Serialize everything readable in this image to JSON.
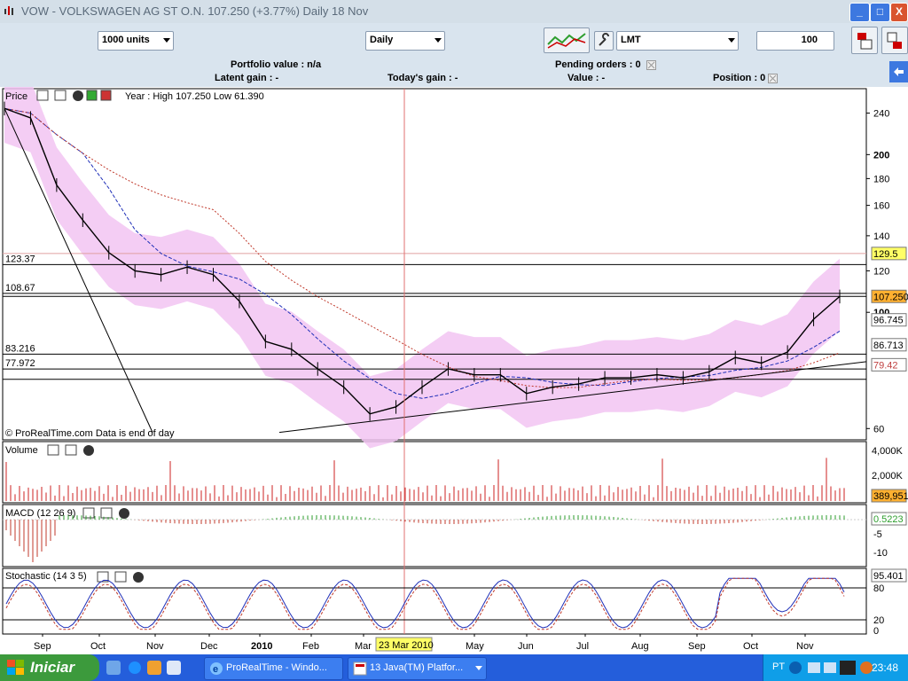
{
  "window": {
    "title": "VOW - VOLKSWAGEN AG ST O.N.    107.250 (+3.77%)    Daily  18 Nov",
    "minimize": "_",
    "maximize": "□",
    "close": "X"
  },
  "toolbar": {
    "units_value": "1000 units",
    "period_value": "Daily",
    "order_type": "LMT",
    "quantity": "100"
  },
  "info": {
    "portfolio_value": "Portfolio value : n/a",
    "pending_orders": "Pending orders : 0",
    "latent_gain": "Latent gain : -",
    "todays_gain": "Today's gain : -",
    "value": "Value : -",
    "position": "Position : 0"
  },
  "colors": {
    "price_line": "#000000",
    "band_fill": "#f2c4f2",
    "ma_blue": "#1f2fb8",
    "ma_red": "#c0392b",
    "volume_bar": "#cc2222",
    "macd_pos": "#2e9e2e",
    "macd_neg": "#c0392b",
    "stoch_k": "#1f2fb8",
    "stoch_d": "#c0392b",
    "highlight": "#ffff66"
  },
  "panels": {
    "price": {
      "title": "Price",
      "year_info": "Year : High 107.250 Low 61.390",
      "footer": "© ProRealTime.com  Data is end of day",
      "left_levels": [
        "123.37",
        "108.67",
        "83.216",
        "77.972"
      ],
      "right_labels": [
        {
          "text": "129.5",
          "style": "yellow"
        },
        {
          "text": "107.250",
          "style": "orange"
        },
        {
          "text": "96.745",
          "style": "boxed"
        },
        {
          "text": "86.713",
          "style": "boxed"
        },
        {
          "text": "79.42",
          "style": "pink"
        }
      ]
    },
    "volume": {
      "title": "Volume",
      "current": "389,951"
    },
    "macd": {
      "title": "MACD (12 26 9)",
      "current": "0.5223"
    },
    "stochastic": {
      "title": "Stochastic (14 3 5)",
      "current": "95.401",
      "ticks": [
        "80",
        "20",
        "0"
      ]
    }
  },
  "crosshair_date": "23 Mar 2010",
  "chart_data": {
    "type": "line",
    "title": "VOW - VOLKSWAGEN AG ST O.N.",
    "x_months": [
      "Sep",
      "Oct",
      "Nov",
      "Dec",
      "2010",
      "Feb",
      "Mar",
      "May",
      "Jun",
      "Jul",
      "Aug",
      "Sep",
      "Oct",
      "Nov"
    ],
    "y_scale": "log",
    "y_ticks": [
      240,
      200,
      180,
      160,
      140,
      120,
      100,
      60
    ],
    "series": [
      {
        "name": "Price",
        "x": [
          "Aug",
          "Aug",
          "Sep",
          "Sep",
          "Sep",
          "Oct",
          "Oct",
          "Nov",
          "Nov",
          "Dec",
          "Dec",
          "Jan",
          "Jan",
          "Feb",
          "Feb",
          "Mar",
          "Mar",
          "Apr",
          "Apr",
          "May",
          "May",
          "Jun",
          "Jun",
          "Jul",
          "Jul",
          "Aug",
          "Aug",
          "Sep",
          "Sep",
          "Oct",
          "Oct",
          "Nov",
          "Nov"
        ],
        "values": [
          245,
          235,
          175,
          150,
          130,
          120,
          118,
          122,
          118,
          105,
          88,
          85,
          78,
          72,
          64,
          66,
          72,
          78,
          76,
          76,
          70,
          72,
          73,
          75,
          75,
          76,
          75,
          77,
          82,
          80,
          84,
          97,
          107.25
        ]
      }
    ],
    "volume_current": 389951,
    "volume_ticks": [
      "4,000K",
      "2,000K"
    ],
    "macd_ticks": [
      "-5",
      "-10"
    ],
    "stoch_ticks": [
      "80",
      "20",
      "0"
    ]
  },
  "taskbar": {
    "start": "Iniciar",
    "items": [
      "ProRealTime - Windo...",
      "13 Java(TM) Platfor..."
    ],
    "lang": "PT",
    "clock": "23:48"
  }
}
